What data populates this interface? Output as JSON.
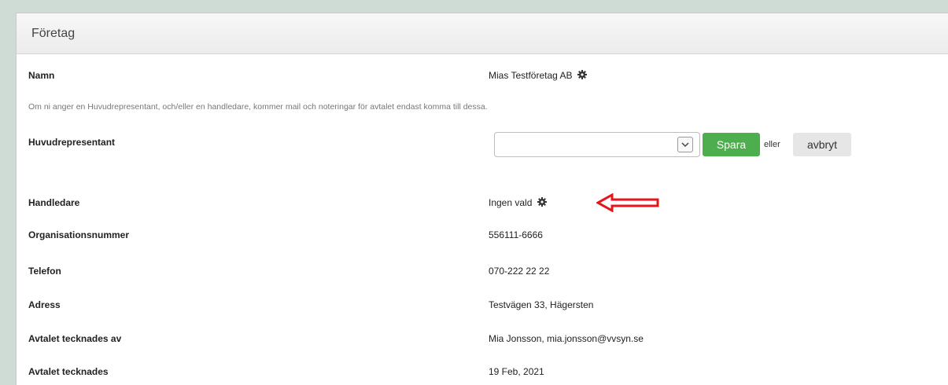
{
  "panel": {
    "title": "Företag"
  },
  "fields": {
    "namn": {
      "label": "Namn",
      "value": "Mias Testföretag AB"
    },
    "info_text": "Om ni anger en Huvudrepresentant, och/eller en handledare, kommer mail och noteringar för avtalet endast komma till dessa.",
    "huvudrepresentant": {
      "label": "Huvudrepresentant",
      "selected": ""
    },
    "handledare": {
      "label": "Handledare",
      "value": "Ingen vald"
    },
    "orgnr": {
      "label": "Organisationsnummer",
      "value": "556111-6666"
    },
    "telefon": {
      "label": "Telefon",
      "value": "070-222 22 22"
    },
    "adress": {
      "label": "Adress",
      "value": "Testvägen 33, Hägersten"
    },
    "tecknad_av": {
      "label": "Avtalet tecknades av",
      "value": "Mia Jonsson, mia.jonsson@vvsyn.se"
    },
    "tecknad": {
      "label": "Avtalet tecknades",
      "value": "19 Feb, 2021"
    }
  },
  "actions": {
    "save_label": "Spara",
    "or_text": "eller",
    "cancel_label": "avbryt"
  },
  "colors": {
    "save": "#4cae4c",
    "annotation_arrow": "#e8141b",
    "background": "#cfdcd6"
  },
  "icons": {
    "settings": "gear-icon",
    "annotation": "left-arrow-icon",
    "dropdown": "chevron-down-icon"
  }
}
